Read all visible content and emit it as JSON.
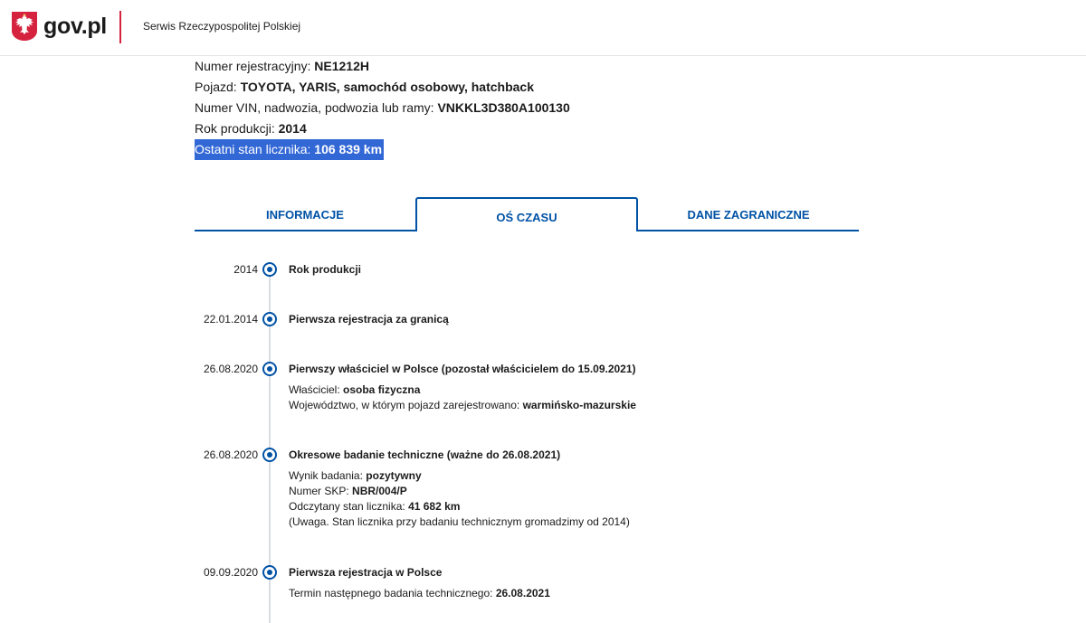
{
  "header": {
    "logo_text": "gov.pl",
    "subtitle": "Serwis Rzeczypospolitej Polskiej"
  },
  "vehicle": {
    "registration_label": "Numer rejestracyjny: ",
    "registration_value": "NE1212H",
    "vehicle_label": "Pojazd: ",
    "vehicle_value": "TOYOTA, YARIS, samochód osobowy, hatchback",
    "vin_label": "Numer VIN, nadwozia, podwozia lub ramy: ",
    "vin_value": "VNKKL3D380A100130",
    "year_label": "Rok produkcji: ",
    "year_value": "2014",
    "odometer_label": "Ostatni stan licznika: ",
    "odometer_value": "106 839 km"
  },
  "tabs": [
    {
      "label": "INFORMACJE",
      "active": false
    },
    {
      "label": "OŚ CZASU",
      "active": true
    },
    {
      "label": "DANE ZAGRANICZNE",
      "active": false
    }
  ],
  "timeline": [
    {
      "date": "2014",
      "title": "Rok produkcji",
      "details": []
    },
    {
      "date": "22.01.2014",
      "title": "Pierwsza rejestracja za granicą",
      "details": []
    },
    {
      "date": "26.08.2020",
      "title": "Pierwszy właściciel w Polsce (pozostał właścicielem do 15.09.2021)",
      "details": [
        {
          "label": "Właściciel: ",
          "value": "osoba fizyczna"
        },
        {
          "label": "Województwo, w którym pojazd zarejestrowano: ",
          "value": "warmińsko-mazurskie"
        }
      ]
    },
    {
      "date": "26.08.2020",
      "title": "Okresowe badanie techniczne (ważne do 26.08.2021)",
      "details": [
        {
          "label": "Wynik badania: ",
          "value": "pozytywny"
        },
        {
          "label": "Numer SKP: ",
          "value": "NBR/004/P"
        },
        {
          "label": "Odczytany stan licznika: ",
          "value": "41 682 km"
        },
        {
          "label": "(Uwaga. Stan licznika przy badaniu technicznym gromadzimy od 2014)",
          "value": ""
        }
      ]
    },
    {
      "date": "09.09.2020",
      "title": "Pierwsza rejestracja w Polsce",
      "details": [
        {
          "label": "Termin następnego badania technicznego: ",
          "value": "26.08.2021"
        }
      ]
    }
  ],
  "colors": {
    "accent": "#0052a5",
    "brand_red": "#d5233f",
    "highlight": "#3267d6"
  }
}
